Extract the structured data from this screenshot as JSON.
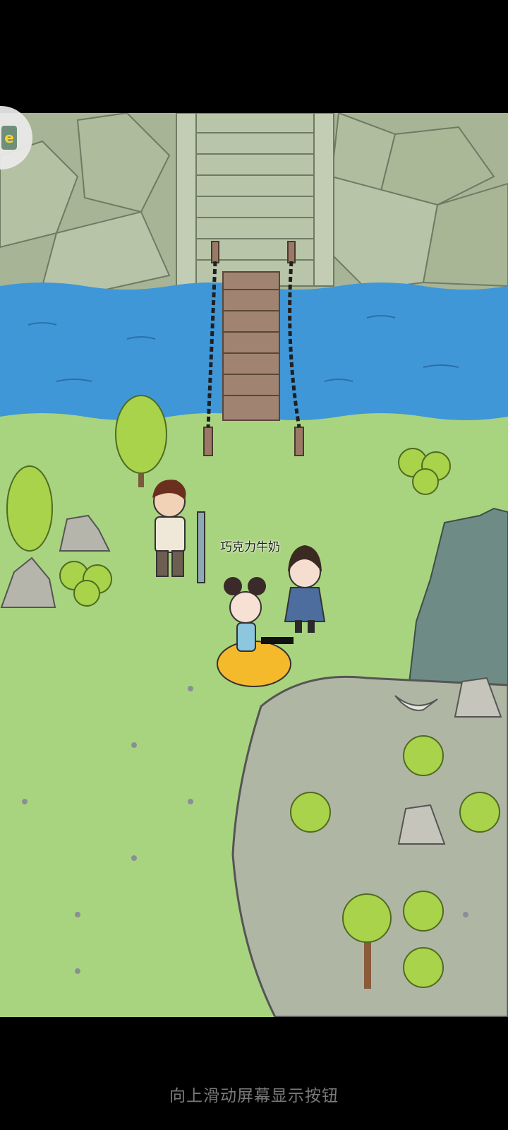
{
  "player": {
    "name": "巧克力牛奶"
  },
  "system": {
    "swipe_hint": "向上滑动屏幕显示按钮"
  },
  "icons": {
    "floating_button": "app-logo-icon"
  },
  "colors": {
    "grass": "#a8d57d",
    "river": "#3f97d8",
    "cliff": "#a7b596",
    "plateau": "#b0b6a4",
    "tree": "#a8d34a"
  }
}
